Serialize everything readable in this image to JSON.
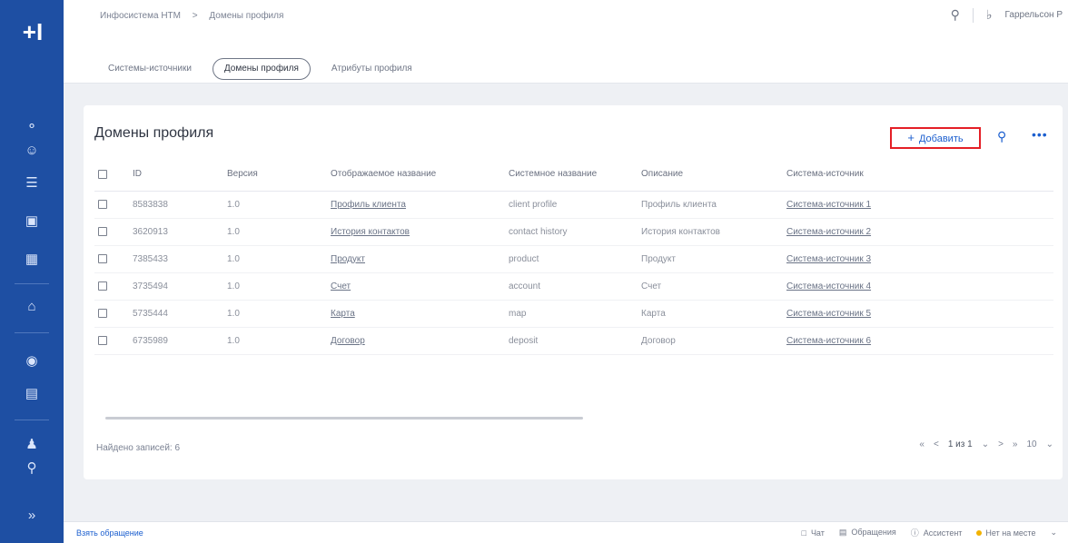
{
  "rail": {
    "logo": "+I",
    "icons": [
      "user-add-icon",
      "users-icon",
      "list-icon",
      "folder-icon",
      "card-icon",
      "home-icon",
      "globe-icon",
      "document-icon",
      "persons-icon",
      "key-icon",
      "expand-icon"
    ]
  },
  "breadcrumb": {
    "root": "Инфосистема НТМ",
    "separator": ">",
    "current": "Домены профиля"
  },
  "topbar": {
    "user": "Гаррельсон Р"
  },
  "tabs": [
    {
      "label": "Системы-источники",
      "active": false
    },
    {
      "label": "Домены профиля",
      "active": true
    },
    {
      "label": "Атрибуты профиля",
      "active": false
    }
  ],
  "main": {
    "title": "Домены профиля",
    "add_label": "Добавить",
    "columns": [
      "ID",
      "Версия",
      "Отображаемое название",
      "Системное название",
      "Описание",
      "Система-источник"
    ],
    "rows": [
      {
        "id": "8583838",
        "version": "1.0",
        "display": "Профиль клиента",
        "system": "client profile",
        "desc": "Профиль клиента",
        "source": "Система-источник 1"
      },
      {
        "id": "3620913",
        "version": "1.0",
        "display": "История контактов",
        "system": "contact history",
        "desc": "История контактов",
        "source": "Система-источник 2"
      },
      {
        "id": "7385433",
        "version": "1.0",
        "display": "Продукт",
        "system": "product",
        "desc": "Продукт",
        "source": "Система-источник 3"
      },
      {
        "id": "3735494",
        "version": "1.0",
        "display": "Счет",
        "system": "account",
        "desc": "Счет",
        "source": "Система-источник 4"
      },
      {
        "id": "5735444",
        "version": "1.0",
        "display": "Карта",
        "system": "map",
        "desc": "Карта",
        "source": "Система-источник 5"
      },
      {
        "id": "6735989",
        "version": "1.0",
        "display": "Договор",
        "system": "deposit",
        "desc": "Договор",
        "source": "Система-источник 6"
      }
    ],
    "records_label": "Найдено записей:",
    "records_count": "6",
    "pager": {
      "first": "«",
      "prev": "<",
      "range": "1 из 1",
      "next": ">",
      "last": "»",
      "per_page": "10"
    }
  },
  "bottombar": {
    "left": "Взять обращение",
    "chat": "Чат",
    "appeals": "Обращения",
    "assistant": "Ассистент",
    "status": "Нет на месте"
  },
  "colors": {
    "rail": "#1e4fa3",
    "accent": "#1c5fcf",
    "highlight": "#e41f26",
    "status": "#f2b200"
  }
}
